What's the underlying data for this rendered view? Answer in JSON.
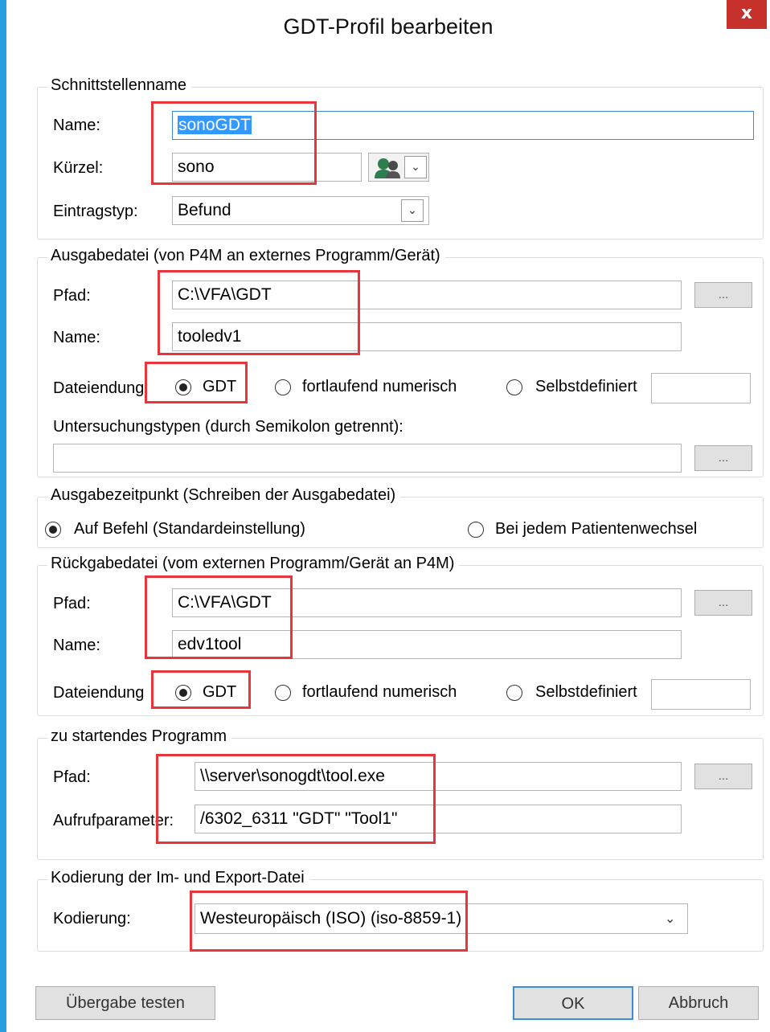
{
  "window": {
    "title": "GDT-Profil bearbeiten",
    "close_label": "x"
  },
  "schnittstelle": {
    "legend": "Schnittstellenname",
    "name_label": "Name:",
    "name_value": "sonoGDT",
    "kuerzel_label": "Kürzel:",
    "kuerzel_value": "sono",
    "eintragstyp_label": "Eintragstyp:",
    "eintragstyp_value": "Befund"
  },
  "ausgabedatei": {
    "legend": "Ausgabedatei (von P4M an externes Programm/Gerät)",
    "pfad_label": "Pfad:",
    "pfad_value": "C:\\VFA\\GDT",
    "browse_label": "...",
    "name_label": "Name:",
    "name_value": "tooledv1",
    "dateiendung_label": "Dateiendung:",
    "options": [
      "GDT",
      "fortlaufend numerisch",
      "Selbstdefiniert"
    ],
    "selected": "GDT",
    "custom_value": "",
    "untersuchung_label": "Untersuchungstypen (durch Semikolon getrennt):",
    "untersuchung_value": "",
    "browse2_label": "..."
  },
  "ausgabezeitpunkt": {
    "legend": "Ausgabezeitpunkt (Schreiben der Ausgabedatei)",
    "options": [
      "Auf Befehl (Standardeinstellung)",
      "Bei jedem Patientenwechsel"
    ],
    "selected": "Auf Befehl (Standardeinstellung)"
  },
  "rueckgabedatei": {
    "legend": "Rückgabedatei (vom externen Programm/Gerät an P4M)",
    "pfad_label": "Pfad:",
    "pfad_value": "C:\\VFA\\GDT",
    "browse_label": "...",
    "name_label": "Name:",
    "name_value": "edv1tool",
    "dateiendung_label": "Dateiendung",
    "options": [
      "GDT",
      "fortlaufend numerisch",
      "Selbstdefiniert"
    ],
    "selected": "GDT",
    "custom_value": ""
  },
  "programm": {
    "legend": "zu startendes Programm",
    "pfad_label": "Pfad:",
    "pfad_value": "\\\\server\\sonogdt\\tool.exe",
    "browse_label": "...",
    "parameter_label": "Aufrufparameter:",
    "parameter_value": "/6302_6311 \"GDT\" \"Tool1\""
  },
  "kodierung": {
    "legend": "Kodierung der Im- und Export-Datei",
    "label": "Kodierung:",
    "value": "Westeuropäisch (ISO) (iso-8859-1)"
  },
  "buttons": {
    "test": "Übergabe testen",
    "ok": "OK",
    "cancel": "Abbruch"
  },
  "colors": {
    "highlight": "#e8343b",
    "accent": "#2b9ee0",
    "close": "#c7312b",
    "selection": "#3399ff"
  }
}
